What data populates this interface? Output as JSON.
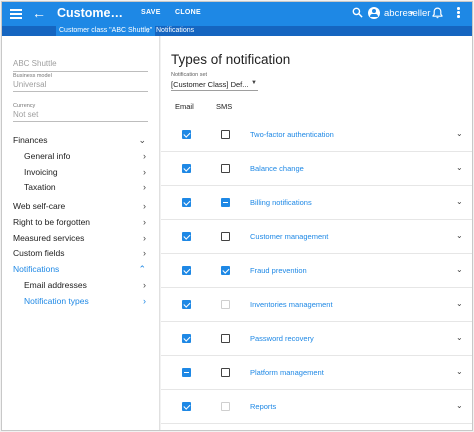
{
  "appbar": {
    "back_glyph": "←",
    "title": "Customer class \"ABC Shuttle\"",
    "save": "SAVE",
    "clone": "CLONE",
    "user": "abcreseller",
    "icons": [
      "menu-icon",
      "back-arrow-icon",
      "search-icon",
      "account-icon",
      "bell-icon",
      "more-vert-icon"
    ]
  },
  "breadcrumb": {
    "items": [
      "Customer class \"ABC Shuttle\"",
      "Notifications"
    ],
    "separator": "›"
  },
  "sidebar": {
    "name_value": "ABC Shuttle",
    "business_model_label": "Business model",
    "business_model_value": "Universal",
    "currency_label": "Currency",
    "currency_value": "Not set",
    "nav": [
      {
        "label": "Finances",
        "chevron": "⌄"
      },
      {
        "label": "General info",
        "chevron": "›"
      },
      {
        "label": "Invoicing",
        "chevron": "›"
      },
      {
        "label": "Taxation",
        "chevron": "›"
      },
      {
        "label": "Web self-care",
        "chevron": "›"
      },
      {
        "label": "Right to be forgotten",
        "chevron": "›"
      },
      {
        "label": "Measured services",
        "chevron": "›"
      },
      {
        "label": "Custom fields",
        "chevron": "›"
      },
      {
        "label": "Notifications",
        "chevron": "⌃"
      },
      {
        "label": "Email addresses",
        "chevron": "›"
      },
      {
        "label": "Notification types",
        "chevron": "›"
      }
    ]
  },
  "main": {
    "title": "Types of notification",
    "set_label": "Notification set",
    "set_value": "[Customer Class] Def...",
    "col_email": "Email",
    "col_sms": "SMS",
    "row_chevron": "⌄",
    "rows": [
      {
        "label": "Two-factor authentication",
        "email": "checked",
        "sms": "empty"
      },
      {
        "label": "Balance change",
        "email": "checked",
        "sms": "empty"
      },
      {
        "label": "Billing notifications",
        "email": "checked",
        "sms": "partial"
      },
      {
        "label": "Customer management",
        "email": "checked",
        "sms": "empty"
      },
      {
        "label": "Fraud prevention",
        "email": "checked",
        "sms": "checked"
      },
      {
        "label": "Inventories management",
        "email": "checked",
        "sms": "disabled"
      },
      {
        "label": "Password recovery",
        "email": "checked",
        "sms": "empty"
      },
      {
        "label": "Platform management",
        "email": "partial",
        "sms": "empty"
      },
      {
        "label": "Reports",
        "email": "checked",
        "sms": "disabled"
      }
    ]
  },
  "colors": {
    "primary": "#1e88e5",
    "primary_dark": "#1565c0"
  }
}
